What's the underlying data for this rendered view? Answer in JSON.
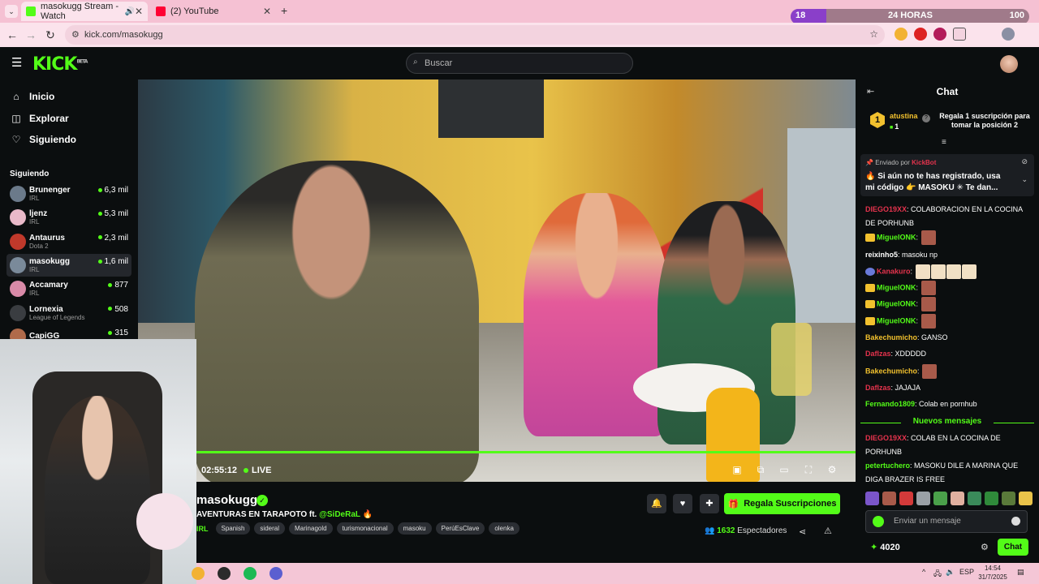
{
  "browser": {
    "tabs": [
      {
        "title": "masokugg Stream - Watch",
        "favicon_color": "#53fc18",
        "active": true
      },
      {
        "title": "(2) YouTube",
        "favicon_color": "#ff0033",
        "active": false
      }
    ],
    "new_tab_symbol": "+",
    "url": "kick.com/masokugg",
    "timer_widget": {
      "left": "18",
      "label": "24 HORAS",
      "right": "100",
      "progress_percent": 15
    }
  },
  "header": {
    "logo": "KICK",
    "logo_badge": "BETA",
    "search_placeholder": "Buscar"
  },
  "sidebar": {
    "nav": [
      {
        "label": "Inicio",
        "icon": "home-icon"
      },
      {
        "label": "Explorar",
        "icon": "compass-icon"
      },
      {
        "label": "Siguiendo",
        "icon": "heart-icon"
      }
    ],
    "following_title": "Siguiendo",
    "following": [
      {
        "name": "Brunenger",
        "category": "IRL",
        "viewers": "6,3 mil",
        "color": "#6b7a8a"
      },
      {
        "name": "ljenz",
        "category": "IRL",
        "viewers": "5,3 mil",
        "color": "#e9b9c9"
      },
      {
        "name": "Antaurus",
        "category": "Dota 2",
        "viewers": "2,3 mil",
        "color": "#c0392b"
      },
      {
        "name": "masokugg",
        "category": "IRL",
        "viewers": "1,6 mil",
        "color": "#7a8a9a"
      },
      {
        "name": "Accamary",
        "category": "IRL",
        "viewers": "877",
        "color": "#d98aa8"
      },
      {
        "name": "Lornexia",
        "category": "League of Legends",
        "viewers": "508",
        "color": "#3a3d41"
      },
      {
        "name": "CapiGG",
        "category": "",
        "viewers": "315",
        "color": "#b06a4a"
      }
    ]
  },
  "player": {
    "elapsed": "02:55:12",
    "live_label": "LIVE"
  },
  "stream": {
    "streamer": "masokugg",
    "title_prefix": "AVENTURAS EN TARAPOTO ft. ",
    "title_mention": "@SiDeRaL",
    "title_emoji": "🔥",
    "category": "IRL",
    "tags": [
      "Spanish",
      "sideral",
      "Marinagold",
      "turismonacional",
      "masoku",
      "PerúEsClave",
      "olenka"
    ],
    "subscribe_label": "Regala Suscripciones",
    "viewers_count": "1632",
    "viewers_label": "Espectadores"
  },
  "chat": {
    "title": "Chat",
    "gift": {
      "rank": "1",
      "user": "atustina",
      "gifts": "1",
      "message": "Regala 1 suscripción para tomar la posición 2"
    },
    "pinned": {
      "sent_by": "Enviado por",
      "bot_name": "KickBot",
      "text": "🔥 Si aún no te has registrado, usa mi código 👉 MASOKU ✳ Te dan..."
    },
    "messages": [
      {
        "user": "DIEGO19XX",
        "color": "#e5334d",
        "text": "COLABORACION EN LA COCINA DE PORHUNB",
        "emotes": 0
      },
      {
        "user": "MiguelONK",
        "color": "#53fc18",
        "text": "",
        "emotes": 1
      },
      {
        "user": "reixinho5",
        "color": "#ffffff",
        "text": "masoku np",
        "emotes": 0
      },
      {
        "user": "Kanakuro",
        "color": "#e5334d",
        "text": "",
        "emotes": 4
      },
      {
        "user": "MiguelONK",
        "color": "#53fc18",
        "text": "",
        "emotes": 1
      },
      {
        "user": "MiguelONK",
        "color": "#53fc18",
        "text": "",
        "emotes": 1
      },
      {
        "user": "MiguelONK",
        "color": "#53fc18",
        "text": "",
        "emotes": 1
      },
      {
        "user": "Bakechumicho",
        "color": "#f2c12e",
        "text": "GANSO",
        "emotes": 0
      },
      {
        "user": "Daflzas",
        "color": "#e5334d",
        "text": "XDDDDD",
        "emotes": 0
      },
      {
        "user": "Bakechumicho",
        "color": "#f2c12e",
        "text": "",
        "emotes": 1
      },
      {
        "user": "Daflzas",
        "color": "#e5334d",
        "text": "JAJAJA",
        "emotes": 0
      },
      {
        "user": "Fernando1809",
        "color": "#53fc18",
        "text": "Colab en pornhub",
        "emotes": 0
      }
    ],
    "new_messages_label": "Nuevos mensajes",
    "new_messages": [
      {
        "user": "DIEGO19XX",
        "color": "#e5334d",
        "text": "COLAB EN LA COCINA DE PORHUNB"
      },
      {
        "user": "petertuchero",
        "color": "#53fc18",
        "text": "MASOKU DILE A MARINA QUE DIGA BRAZER IS FREE"
      }
    ],
    "input_placeholder": "Enviar un mensaje",
    "points": "4020",
    "send_label": "Chat"
  },
  "taskbar": {
    "lang": "ESP",
    "time": "14:54",
    "date": "31/7/2025"
  }
}
